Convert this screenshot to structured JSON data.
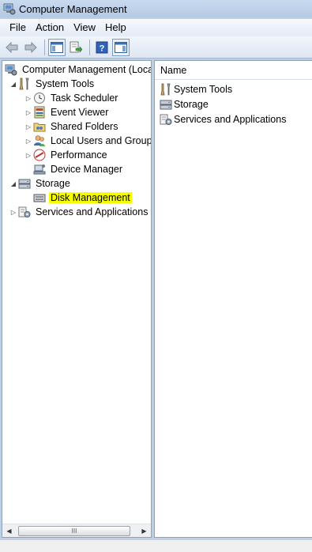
{
  "window": {
    "title": "Computer Management"
  },
  "menu": [
    {
      "label": "File"
    },
    {
      "label": "Action"
    },
    {
      "label": "View"
    },
    {
      "label": "Help"
    }
  ],
  "tree": {
    "root": "Computer Management (Local",
    "system_tools": "System Tools",
    "task_scheduler": "Task Scheduler",
    "event_viewer": "Event Viewer",
    "shared_folders": "Shared Folders",
    "local_users": "Local Users and Groups",
    "performance": "Performance",
    "device_manager": "Device Manager",
    "storage": "Storage",
    "disk_management": "Disk Management",
    "services": "Services and Applications",
    "selected_item": "Disk Management",
    "highlight_color": "#f6ff00"
  },
  "list": {
    "column_name": "Name",
    "items": [
      {
        "label": "System Tools",
        "icon": "tools-icon"
      },
      {
        "label": "Storage",
        "icon": "storage-icon"
      },
      {
        "label": "Services and Applications",
        "icon": "services-icon"
      }
    ]
  },
  "scrollbar": {
    "thumb_grip": "III"
  }
}
